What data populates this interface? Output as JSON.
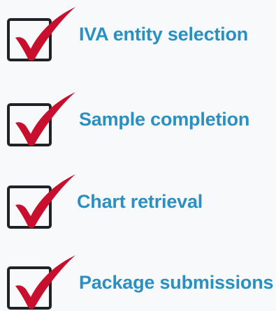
{
  "colors": {
    "label_text": "#2a8fc1",
    "check_red": "#c8102e",
    "box_border": "#1f2326",
    "background": "#f7f9fb"
  },
  "checklist": {
    "items": [
      {
        "label": "IVA entity selection",
        "checked": true,
        "icon": "checkmark-icon"
      },
      {
        "label": "Sample completion",
        "checked": true,
        "icon": "checkmark-icon"
      },
      {
        "label": "Chart retrieval",
        "checked": true,
        "icon": "checkmark-icon"
      },
      {
        "label": "Package submissions",
        "checked": true,
        "icon": "checkmark-icon"
      }
    ]
  }
}
